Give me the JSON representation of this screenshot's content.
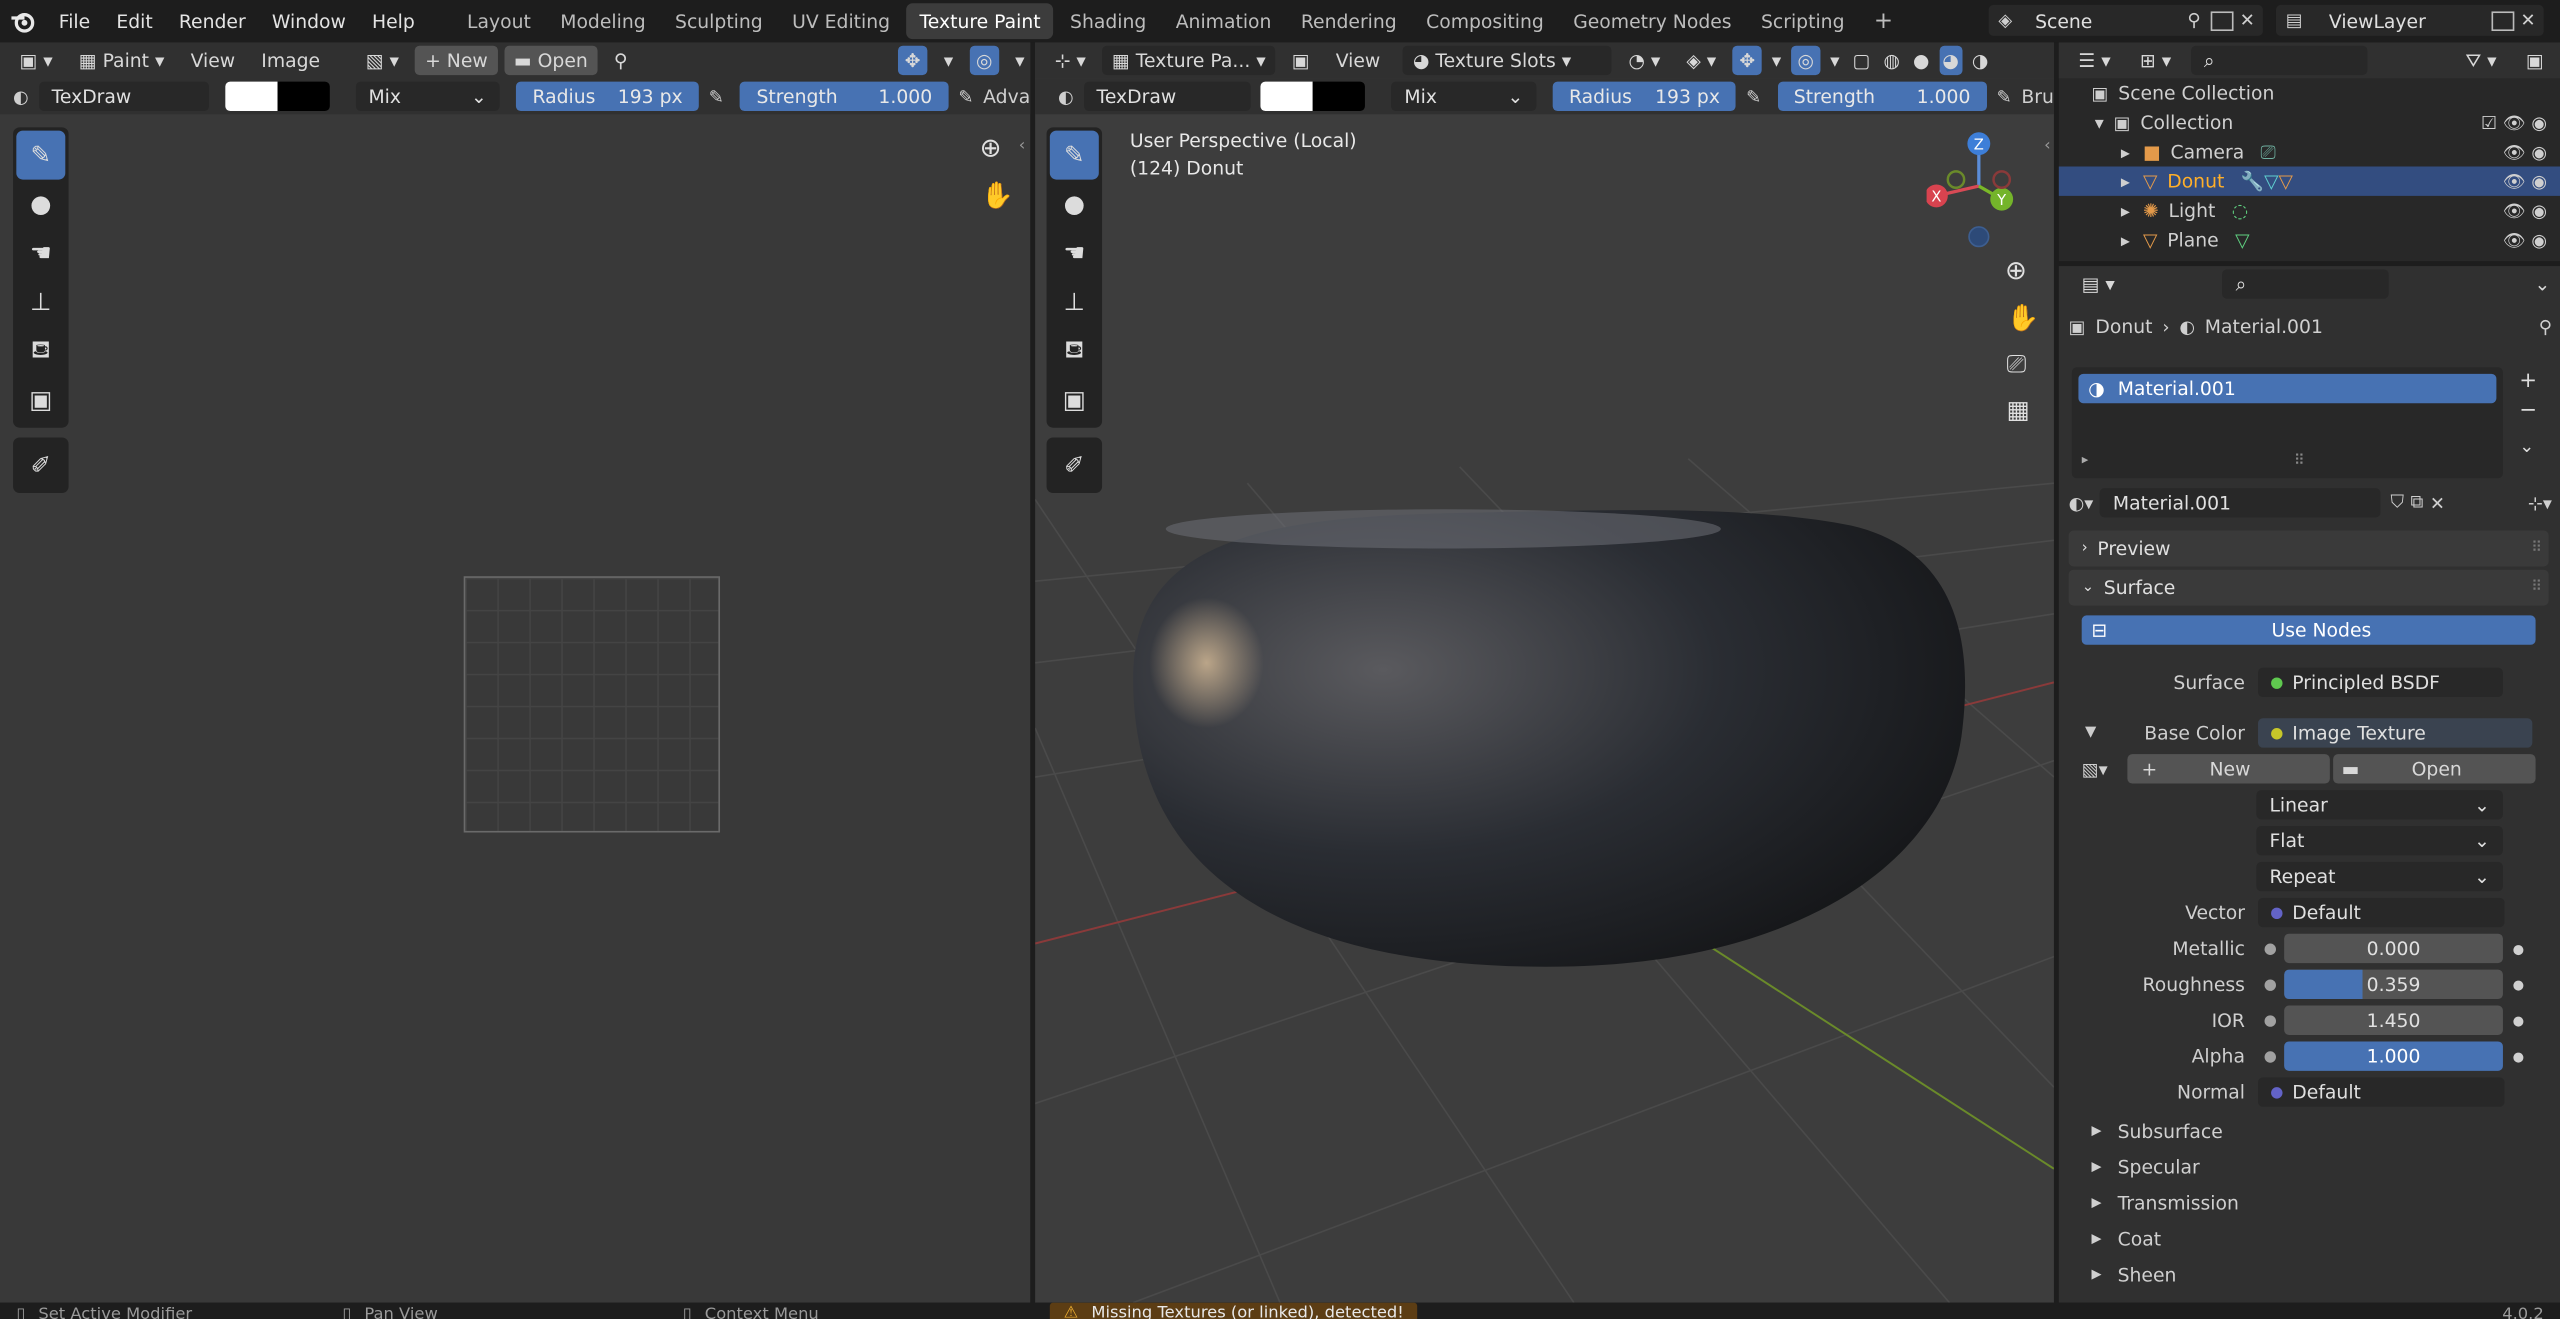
{
  "menu": [
    "File",
    "Edit",
    "Render",
    "Window",
    "Help"
  ],
  "workspaces": [
    "Layout",
    "Modeling",
    "Sculpting",
    "UV Editing",
    "Texture Paint",
    "Shading",
    "Animation",
    "Rendering",
    "Compositing",
    "Geometry Nodes",
    "Scripting"
  ],
  "active_workspace": "Texture Paint",
  "scene": "Scene",
  "view_layer": "ViewLayer",
  "image_editor": {
    "mode": "Paint",
    "view": "View",
    "image": "Image",
    "new": "New",
    "open": "Open",
    "brush": "TexDraw",
    "blend": "Mix",
    "radius_label": "Radius",
    "radius_value": "193 px",
    "strength_label": "Strength",
    "strength_value": "1.000",
    "advanced": "Adva"
  },
  "viewport": {
    "mode": "Texture Pa...",
    "view": "View",
    "slots": "Texture Slots",
    "brush": "TexDraw",
    "blend": "Mix",
    "radius_label": "Radius",
    "radius_value": "193 px",
    "strength_label": "Strength",
    "strength_value": "1.000",
    "brush_trunc": "Bru",
    "perspective": "User Perspective (Local)",
    "object_info": "(124) Donut",
    "gizmo": {
      "x": "X",
      "y": "Y",
      "z": "Z"
    }
  },
  "outliner": {
    "root": "Scene Collection",
    "collection": "Collection",
    "items": [
      {
        "name": "Camera",
        "active": false
      },
      {
        "name": "Donut",
        "active": true
      },
      {
        "name": "Light",
        "active": false
      },
      {
        "name": "Plane",
        "active": false
      }
    ]
  },
  "properties": {
    "breadcrumb_object": "Donut",
    "breadcrumb_material": "Material.001",
    "slot": "Material.001",
    "material_name": "Material.001",
    "preview": "Preview",
    "surface_section": "Surface",
    "use_nodes": "Use Nodes",
    "surface_label": "Surface",
    "surface_value": "Principled BSDF",
    "base_color_label": "Base Color",
    "base_color_value": "Image Texture",
    "img_new": "New",
    "img_open": "Open",
    "interpolation": "Linear",
    "projection": "Flat",
    "extension": "Repeat",
    "vector_label": "Vector",
    "vector_value": "Default",
    "metallic_label": "Metallic",
    "metallic_value": "0.000",
    "roughness_label": "Roughness",
    "roughness_value": "0.359",
    "roughness_fraction": 0.359,
    "ior_label": "IOR",
    "ior_value": "1.450",
    "alpha_label": "Alpha",
    "alpha_value": "1.000",
    "normal_label": "Normal",
    "normal_value": "Default",
    "subsections": [
      "Subsurface",
      "Specular",
      "Transmission",
      "Coat",
      "Sheen"
    ]
  },
  "status": {
    "left": "Set Active Modifier",
    "mid": "Pan View",
    "right": "Context Menu",
    "warning": "Missing Textures (or linked), detected!",
    "version": "4.0.2"
  },
  "colors": {
    "accent": "#4772b3",
    "bg": "#1d1d1d",
    "panel": "#303030",
    "viewport": "#3d3d3d"
  }
}
